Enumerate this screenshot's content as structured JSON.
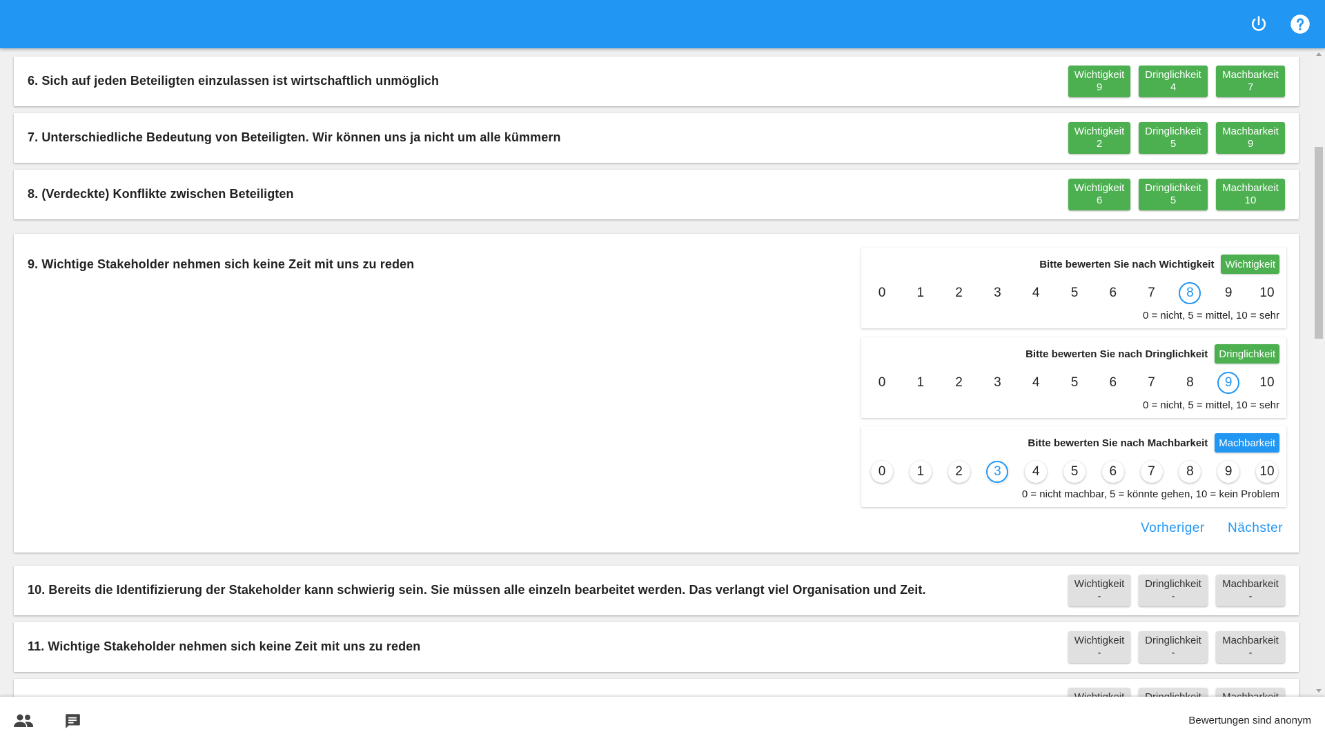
{
  "header": {
    "power_icon": "power-icon",
    "help_icon": "help-icon",
    "bar_color": "#2196f3"
  },
  "questions": [
    {
      "title": "6. Sich auf jeden Beteiligten einzulassen ist wirtschaftlich unmöglich",
      "chips": [
        {
          "label": "Wichtigkeit",
          "value": "9"
        },
        {
          "label": "Dringlichkeit",
          "value": "4"
        },
        {
          "label": "Machbarkeit",
          "value": "7"
        }
      ]
    },
    {
      "title": "7. Unterschiedliche Bedeutung von Beteiligten. Wir können uns ja nicht um alle kümmern",
      "chips": [
        {
          "label": "Wichtigkeit",
          "value": "2"
        },
        {
          "label": "Dringlichkeit",
          "value": "5"
        },
        {
          "label": "Machbarkeit",
          "value": "9"
        }
      ]
    },
    {
      "title": "8. (Verdeckte) Konflikte zwischen Beteiligten",
      "chips": [
        {
          "label": "Wichtigkeit",
          "value": "6"
        },
        {
          "label": "Dringlichkeit",
          "value": "5"
        },
        {
          "label": "Machbarkeit",
          "value": "10"
        }
      ]
    },
    {
      "title": "10. Bereits die Identifizierung der Stakeholder kann schwierig sein. Sie müssen alle einzeln bearbeitet werden. Das verlangt viel Organisation und Zeit.",
      "chips": [
        {
          "label": "Wichtigkeit",
          "value": "-"
        },
        {
          "label": "Dringlichkeit",
          "value": "-"
        },
        {
          "label": "Machbarkeit",
          "value": "-"
        }
      ]
    },
    {
      "title": "11. Wichtige Stakeholder nehmen sich keine Zeit mit uns zu reden",
      "chips": [
        {
          "label": "Wichtigkeit",
          "value": "-"
        },
        {
          "label": "Dringlichkeit",
          "value": "-"
        },
        {
          "label": "Machbarkeit",
          "value": "-"
        }
      ]
    },
    {
      "title": "",
      "chips": [
        {
          "label": "Wichtigkeit",
          "value": "-"
        },
        {
          "label": "Dringlichkeit",
          "value": "-"
        },
        {
          "label": "Machbarkeit",
          "value": "-"
        }
      ]
    }
  ],
  "current": {
    "title": "9. Wichtige Stakeholder nehmen sich keine Zeit mit uns zu reden",
    "scale": [
      "0",
      "1",
      "2",
      "3",
      "4",
      "5",
      "6",
      "7",
      "8",
      "9",
      "10"
    ],
    "ratings": [
      {
        "prompt": "Bitte bewerten Sie nach Wichtigkeit",
        "tag": "Wichtigkeit",
        "tag_color": "#4caf50",
        "selected": 8,
        "legend": "0 = nicht, 5 = mittel, 10 = sehr"
      },
      {
        "prompt": "Bitte bewerten Sie nach Dringlichkeit",
        "tag": "Dringlichkeit",
        "tag_color": "#4caf50",
        "selected": 9,
        "legend": "0 = nicht, 5 = mittel, 10 = sehr"
      },
      {
        "prompt": "Bitte bewerten Sie nach Machbarkeit",
        "tag": "Machbarkeit",
        "tag_color": "#2196f3",
        "selected": 3,
        "legend": "0 = nicht machbar, 5 = könnte gehen, 10 = kein Problem"
      }
    ],
    "prev_label": "Vorheriger",
    "next_label": "Nächster"
  },
  "footer": {
    "people_icon": "people-icon",
    "chat_icon": "chat-icon",
    "status": "Bewertungen sind anonym"
  }
}
